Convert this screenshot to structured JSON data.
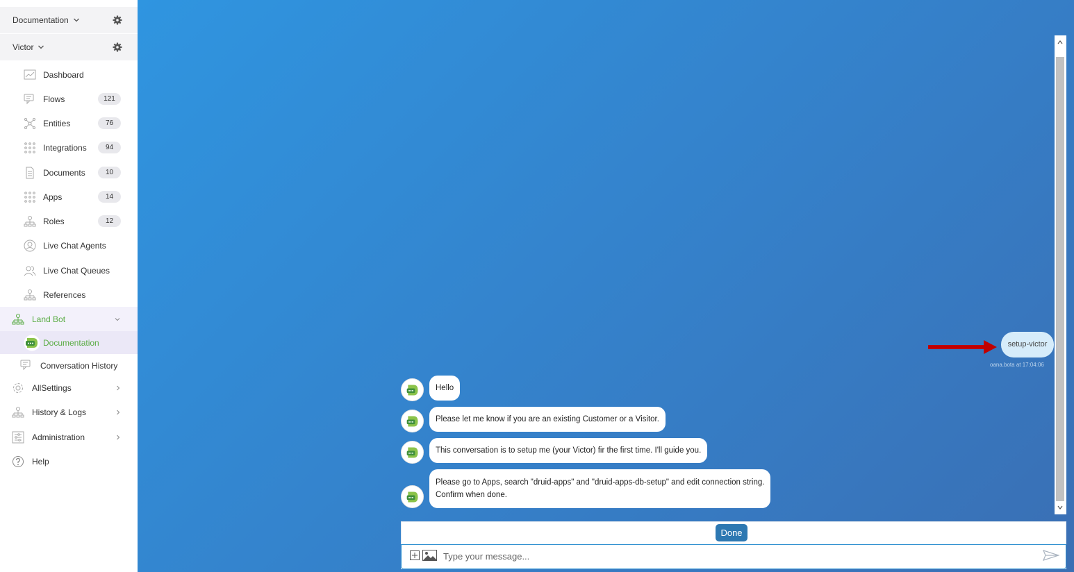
{
  "sidebar": {
    "workspace_selector": "Documentation",
    "bot_selector": "Victor",
    "items": [
      {
        "key": "dashboard",
        "label": "Dashboard",
        "badge": ""
      },
      {
        "key": "flows",
        "label": "Flows",
        "badge": "121"
      },
      {
        "key": "entities",
        "label": "Entities",
        "badge": "76"
      },
      {
        "key": "integrations",
        "label": "Integrations",
        "badge": "94"
      },
      {
        "key": "documents",
        "label": "Documents",
        "badge": "10"
      },
      {
        "key": "apps",
        "label": "Apps",
        "badge": "14"
      },
      {
        "key": "roles",
        "label": "Roles",
        "badge": "12"
      },
      {
        "key": "live-chat-agents",
        "label": "Live Chat Agents",
        "badge": ""
      },
      {
        "key": "live-chat-queues",
        "label": "Live Chat Queues",
        "badge": ""
      },
      {
        "key": "references",
        "label": "References",
        "badge": ""
      }
    ],
    "land_bot": {
      "label": "Land Bot",
      "children": [
        {
          "label": "Documentation"
        },
        {
          "label": "Conversation History"
        }
      ]
    },
    "bottom_items": [
      {
        "label": "AllSettings"
      },
      {
        "label": "History & Logs"
      },
      {
        "label": "Administration"
      },
      {
        "label": "Help"
      }
    ]
  },
  "chat": {
    "user_message": {
      "text": "setup-victor",
      "meta": "oana.bota at 17:04:06"
    },
    "bot_messages": [
      {
        "lines": [
          "Hello"
        ]
      },
      {
        "lines": [
          "Please let me know if you are an existing Customer or a Visitor."
        ]
      },
      {
        "lines": [
          "This conversation is to setup me (your Victor) fir the first time. I'll guide you."
        ]
      },
      {
        "lines": [
          "Please go to Apps, search \"druid-apps\" and \"druid-apps-db-setup\" and edit connection string.",
          "Confirm when done."
        ]
      }
    ],
    "quick_reply": "Done",
    "input_placeholder": "Type your message..."
  },
  "colors": {
    "accent_green": "#5aac44",
    "background_blue": "#2f95e0",
    "user_bubble": "#d6ecfa",
    "button_blue": "#2d78b2",
    "annotation_arrow": "#c00000"
  }
}
